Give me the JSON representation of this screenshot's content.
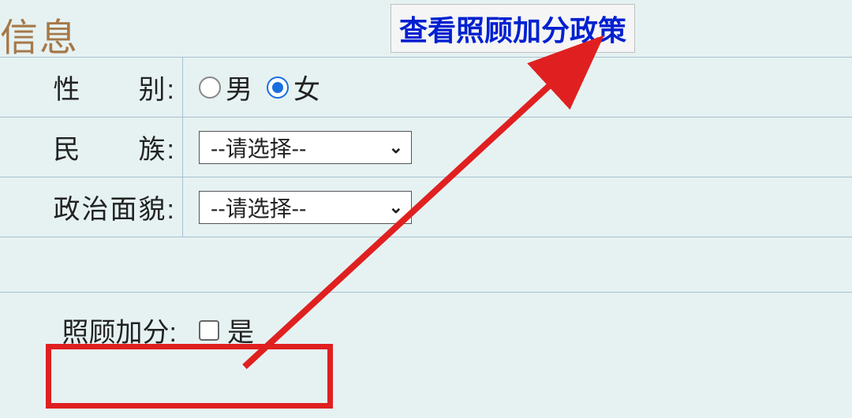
{
  "section": {
    "title_fragment": "信息"
  },
  "policy_link": {
    "label": "查看照顾加分政策"
  },
  "fields": {
    "gender": {
      "label": "性　　别:",
      "option_male": "男",
      "option_female": "女",
      "selected": "female"
    },
    "ethnicity": {
      "label": "民　　族:",
      "placeholder": "--请选择--"
    },
    "political": {
      "label": "政治面貌:",
      "placeholder": "--请选择--"
    },
    "bonus": {
      "label": "照顾加分:",
      "checkbox_label": "是",
      "checked": false
    }
  }
}
